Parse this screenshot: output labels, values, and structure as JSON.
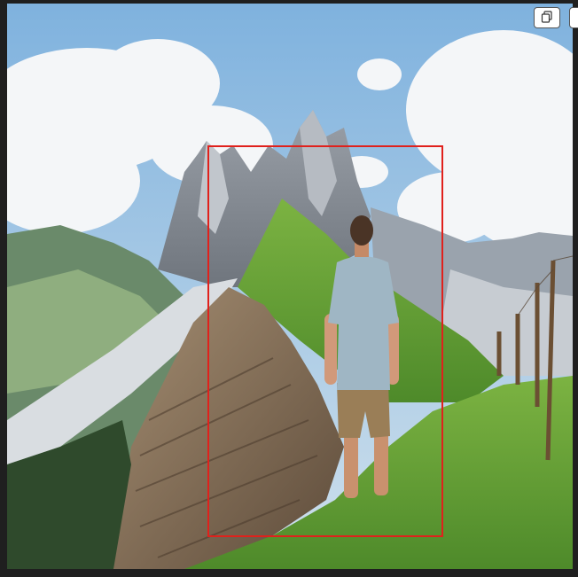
{
  "toolbar": {
    "copy_icon": "copy-icon"
  },
  "image": {
    "subject": "person-on-mountain-ridge"
  },
  "annotation": {
    "color": "#e0211c"
  }
}
